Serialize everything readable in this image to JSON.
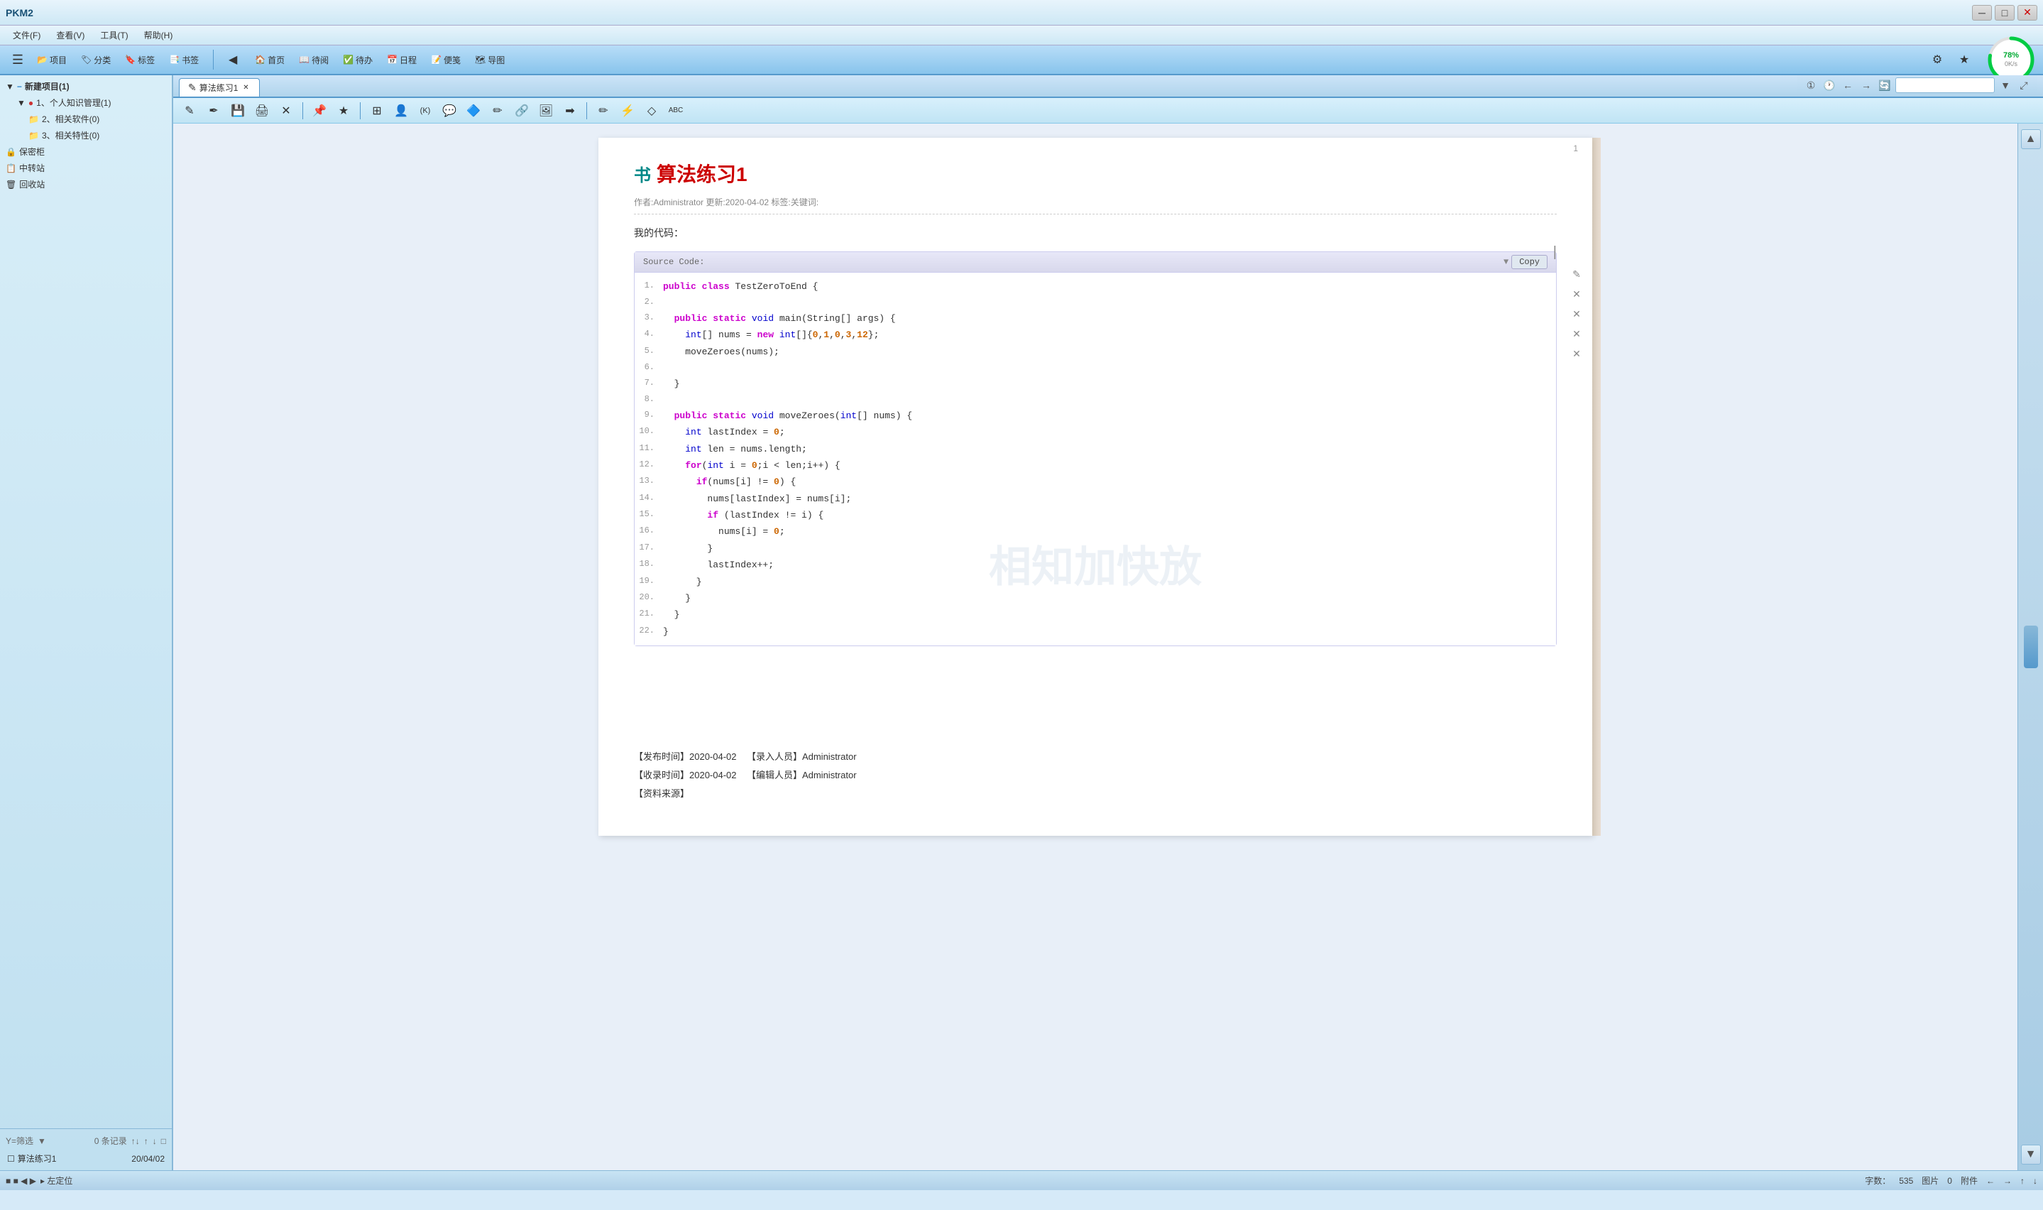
{
  "app": {
    "title": "PKM2",
    "window_controls": [
      "minimize",
      "maximize",
      "close"
    ]
  },
  "menubar": {
    "items": [
      "文件(F)",
      "查看(V)",
      "工具(T)",
      "帮助(H)"
    ]
  },
  "toolbar": {
    "left_icon": "☰",
    "items": [
      "项目",
      "分类",
      "标签",
      "书签"
    ],
    "nav_items": [
      "首页",
      "待阅",
      "待办",
      "日程",
      "便笺",
      "导图"
    ],
    "settings_icon": "⚙",
    "star_icon": "★"
  },
  "sidebar": {
    "tree_items": [
      {
        "label": "新建项目(1)",
        "level": 0,
        "icon": "🔷"
      },
      {
        "label": "1、个人知识管理(1)",
        "level": 1,
        "icon": "🔴"
      },
      {
        "label": "2、相关软件(0)",
        "level": 1,
        "icon": "📁"
      },
      {
        "label": "3、相关特性(0)",
        "level": 1,
        "icon": "📁"
      },
      {
        "label": "保密柜",
        "level": 0,
        "icon": "🔒"
      },
      {
        "label": "中转站",
        "level": 0,
        "icon": "📋"
      },
      {
        "label": "回收站",
        "level": 0,
        "icon": "🗑"
      }
    ],
    "filter_label": "Y=筛选",
    "record_count": "0 条记录",
    "sort_icons": [
      "↑↓",
      "↑",
      "↓"
    ],
    "records": [
      {
        "name": "算法练习1",
        "date": "20/04/02"
      }
    ]
  },
  "tabs": [
    {
      "label": "算法练习1",
      "active": true
    }
  ],
  "doc_toolbar": {
    "buttons": [
      "✎",
      "🖫",
      "⎙",
      "✂",
      "📌",
      "★",
      "⊞",
      "👤",
      "(K)",
      "💬",
      "🔷",
      "✏",
      "🔗",
      "🖼",
      "➡",
      "✏",
      "⚡",
      "◇",
      "ABC"
    ]
  },
  "tab_nav": {
    "icons": [
      "①",
      "🕐",
      "←",
      "→",
      "🔄"
    ],
    "search_placeholder": ""
  },
  "document": {
    "title": "算法练习1",
    "title_icon": "书",
    "meta": "作者:Administrator  更新:2020-04-02  标签:关键词:",
    "body_label": "我的代码：",
    "code_header": "Source Code:",
    "copy_button": "Copy",
    "code_lines": [
      {
        "num": "1.",
        "code": "public class TestZeroToEnd {"
      },
      {
        "num": "2.",
        "code": ""
      },
      {
        "num": "3.",
        "code": "  public static void main(String[] args) {"
      },
      {
        "num": "4.",
        "code": "    int[] nums = new int[]{0,1,0,3,12};"
      },
      {
        "num": "5.",
        "code": "    moveZeroes(nums);"
      },
      {
        "num": "6.",
        "code": ""
      },
      {
        "num": "7.",
        "code": "  }"
      },
      {
        "num": "8.",
        "code": ""
      },
      {
        "num": "9.",
        "code": "  public static void moveZeroes(int[] nums) {"
      },
      {
        "num": "10.",
        "code": "    int lastIndex = 0;"
      },
      {
        "num": "11.",
        "code": "    int len = nums.length;"
      },
      {
        "num": "12.",
        "code": "    for(int i = 0;i < len;i++) {"
      },
      {
        "num": "13.",
        "code": "      if(nums[i] != 0) {"
      },
      {
        "num": "14.",
        "code": "        nums[lastIndex] = nums[i];"
      },
      {
        "num": "15.",
        "code": "        if (lastIndex != i) {"
      },
      {
        "num": "16.",
        "code": "          nums[i] = 0;"
      },
      {
        "num": "17.",
        "code": "        }"
      },
      {
        "num": "18.",
        "code": "        lastIndex++;"
      },
      {
        "num": "19.",
        "code": "      }"
      },
      {
        "num": "20.",
        "code": "    }"
      },
      {
        "num": "21.",
        "code": "  }"
      },
      {
        "num": "22.",
        "code": "}"
      }
    ],
    "footer": {
      "publish_time": "【发布时间】2020-04-02",
      "recorder": "【录入人员】Administrator",
      "collect_time": "【收录时间】2020-04-02",
      "editor": "【编辑人员】Administrator",
      "source": "【资料来源】"
    }
  },
  "progress": {
    "value": 78,
    "label": "78%",
    "sublabel": "0K/s"
  },
  "page_number": "1",
  "statusbar": {
    "word_count_label": "字数：",
    "word_count": "535",
    "image_label": "图片",
    "image_count": "0",
    "attachment_label": "附件",
    "attachment_count": "",
    "nav_icons": [
      "←",
      "→",
      "↑",
      "↓"
    ]
  }
}
